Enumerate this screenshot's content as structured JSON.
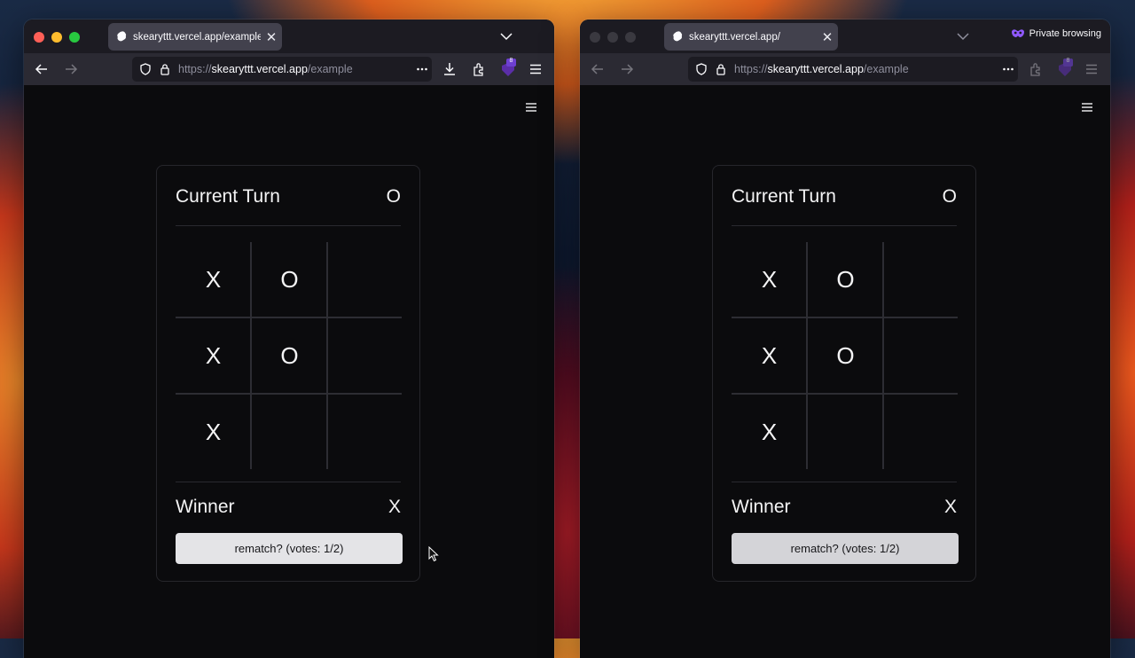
{
  "windows": [
    {
      "id": "left",
      "tab": {
        "title": "skearyttt.vercel.app/example",
        "close": "✕"
      },
      "url": {
        "scheme": "https://",
        "host": "skearyttt.vercel.app",
        "path": "/example"
      },
      "extension_badge": "8",
      "private_label": "",
      "game": {
        "turn_label": "Current Turn",
        "turn_value": "O",
        "board": [
          [
            "X",
            "O",
            ""
          ],
          [
            "X",
            "O",
            ""
          ],
          [
            "X",
            "",
            ""
          ]
        ],
        "winner_label": "Winner",
        "winner_value": "X",
        "rematch_label": "rematch? (votes: 1/2)"
      }
    },
    {
      "id": "right",
      "tab": {
        "title": "skearyttt.vercel.app/",
        "close": "✕"
      },
      "url": {
        "scheme": "https://",
        "host": "skearyttt.vercel.app",
        "path": "/example"
      },
      "extension_badge": "8",
      "private_label": "Private browsing",
      "game": {
        "turn_label": "Current Turn",
        "turn_value": "O",
        "board": [
          [
            "X",
            "O",
            ""
          ],
          [
            "X",
            "O",
            ""
          ],
          [
            "X",
            "",
            ""
          ]
        ],
        "winner_label": "Winner",
        "winner_value": "X",
        "rematch_label": "rematch? (votes: 1/2)"
      }
    }
  ],
  "colors": {
    "accent_private": "#8000d7",
    "extension_badge": "#5b2ea8",
    "traffic_red": "#fe5f57",
    "traffic_yellow": "#febc2e",
    "traffic_green": "#28c840"
  },
  "icons": [
    "back-arrow-icon",
    "forward-arrow-icon",
    "shield-icon",
    "lock-icon",
    "more-icon",
    "download-icon",
    "extensions-icon",
    "hamburger-menu-icon",
    "chevron-down-icon",
    "private-mask-icon",
    "mouse-cursor-icon"
  ]
}
